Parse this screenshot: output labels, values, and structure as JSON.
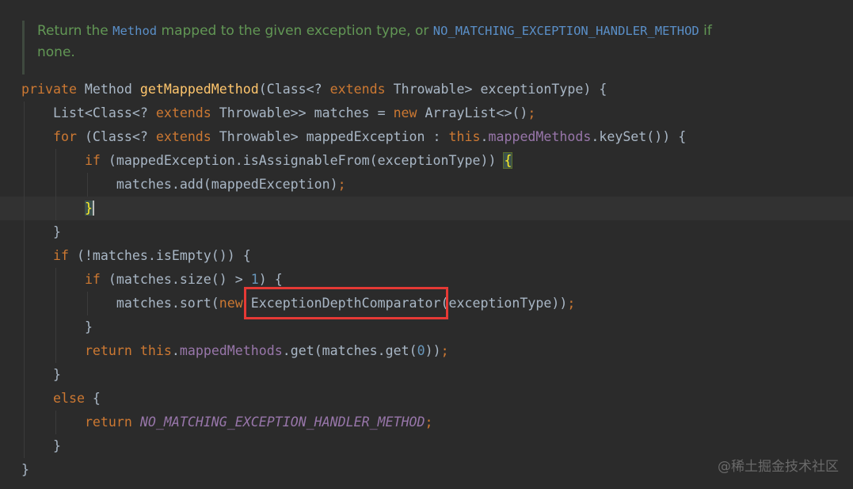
{
  "doc_comment": {
    "line1_text_a": "Return the ",
    "line1_code_a": "Method",
    "line1_text_b": " mapped to the given exception type, or ",
    "line1_code_b": "NO_MATCHING_EXCEPTION_HANDLER_METHOD",
    "line1_text_c": " if",
    "line2_text": "none."
  },
  "code": {
    "l1": {
      "kw_private": "private",
      "t1": " Method ",
      "fn_name": "getMappedMethod",
      "t2": "(Class<? ",
      "kw_extends": "extends",
      "t3": " Throwable> exceptionType) {"
    },
    "l2": {
      "t1": "List<Class<? ",
      "kw_extends": "extends",
      "t2": " Throwable>> matches = ",
      "kw_new": "new",
      "t3": " ArrayList<>()",
      "semi": ";"
    },
    "l3": {
      "kw_for": "for",
      "t1": " (Class<? ",
      "kw_extends": "extends",
      "t2": " Throwable> mappedException : ",
      "kw_this": "this",
      "dot": ".",
      "field": "mappedMethods",
      "t3": ".keySet()) {"
    },
    "l4": {
      "kw_if": "if",
      "t1": " (mappedException.isAssignableFrom(exceptionType)) ",
      "brace": "{"
    },
    "l5": {
      "t1": "matches.add(mappedException)",
      "semi": ";"
    },
    "l6": {
      "brace": "}"
    },
    "l7": {
      "t1": "}"
    },
    "l8": {
      "kw_if": "if",
      "t1": " (!matches.isEmpty()) {"
    },
    "l9": {
      "kw_if": "if",
      "t1": " (matches.size() > ",
      "num": "1",
      "t2": ") {"
    },
    "l10": {
      "t1": "matches.sort(",
      "kw_new": "new",
      "t2": " ExceptionDepthComparator(exceptionType))",
      "semi": ";"
    },
    "l11": {
      "t1": "}"
    },
    "l12": {
      "kw_return": "return",
      "t1": " ",
      "kw_this": "this",
      "dot": ".",
      "field": "mappedMethods",
      "t2": ".get(matches.get(",
      "num": "0",
      "t3": "))",
      "semi": ";"
    },
    "l13": {
      "t1": "}"
    },
    "l14": {
      "kw_else": "else",
      "t1": " {"
    },
    "l15": {
      "kw_return": "return",
      "t1": " ",
      "const": "NO_MATCHING_EXCEPTION_HANDLER_METHOD",
      "semi": ";"
    },
    "l16": {
      "t1": "}"
    },
    "l17": {
      "t1": "}"
    }
  },
  "watermark": "@稀土掘金技术社区",
  "colors": {
    "background": "#2b2b2b",
    "keyword": "#cc7832",
    "method_decl": "#ffc66d",
    "field": "#9876aa",
    "number": "#6897bb",
    "comment": "#629755",
    "highlight_box": "#e53935"
  }
}
